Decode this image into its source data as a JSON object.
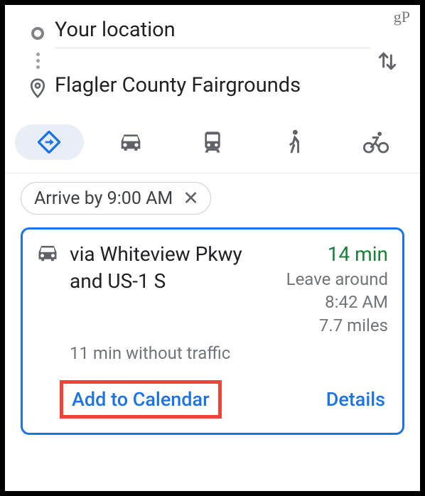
{
  "watermark": "gP",
  "directions": {
    "origin": "Your location",
    "destination": "Flagler County Fairgrounds"
  },
  "modes": {
    "items": [
      {
        "name": "best",
        "active": true
      },
      {
        "name": "drive",
        "active": false
      },
      {
        "name": "transit",
        "active": false
      },
      {
        "name": "walk",
        "active": false
      },
      {
        "name": "bike",
        "active": false
      }
    ]
  },
  "filter": {
    "arrive_by": "Arrive by 9:00 AM"
  },
  "route": {
    "via": "via Whiteview Pkwy and US-1 S",
    "without_traffic": "11 min without traffic",
    "duration": "14 min",
    "leave_around_label": "Leave around",
    "leave_time": "8:42 AM",
    "distance": "7.7 miles",
    "actions": {
      "add_to_calendar": "Add to Calendar",
      "details": "Details"
    }
  }
}
